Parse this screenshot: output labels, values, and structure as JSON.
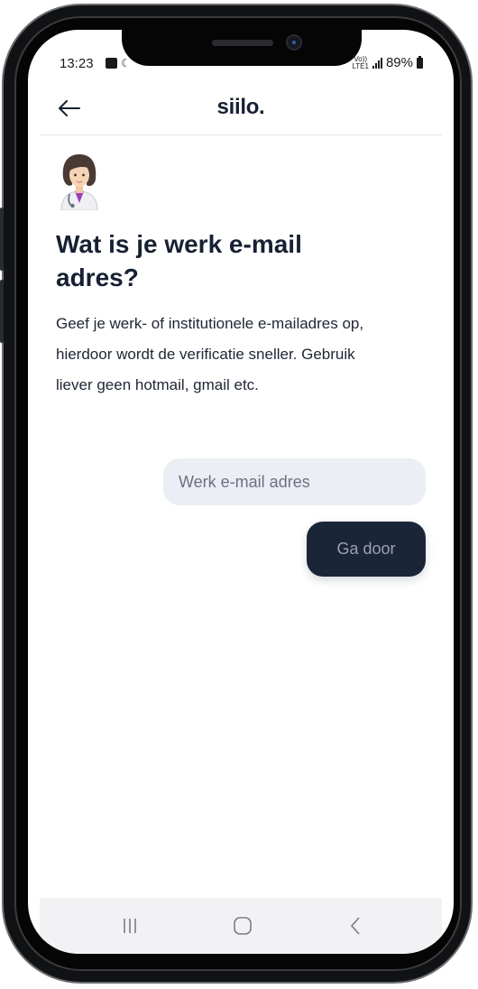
{
  "status_bar": {
    "time": "13:23",
    "network_top": "Vo))",
    "network_bottom": "LTE1",
    "battery": "89%"
  },
  "header": {
    "logo": "siilo.",
    "back_icon": "arrow-left-icon"
  },
  "main": {
    "avatar_icon": "doctor-woman-emoji",
    "title": "Wat is je werk e-mail adres?",
    "description": "Geef je werk- of institutionele e-mailadres op, hierdoor wordt de verificatie sneller. Gebruik liever geen hotmail, gmail etc.",
    "email": {
      "value": "",
      "placeholder": "Werk e-mail adres"
    },
    "continue_label": "Ga door"
  },
  "nav_bar": {
    "items": [
      "recent-apps-icon",
      "home-icon",
      "back-chevron-icon"
    ]
  },
  "colors": {
    "primary_dark": "#1b2538",
    "title_text": "#172033",
    "input_background": "#eceef5",
    "button_text": "#9aa1b3"
  }
}
